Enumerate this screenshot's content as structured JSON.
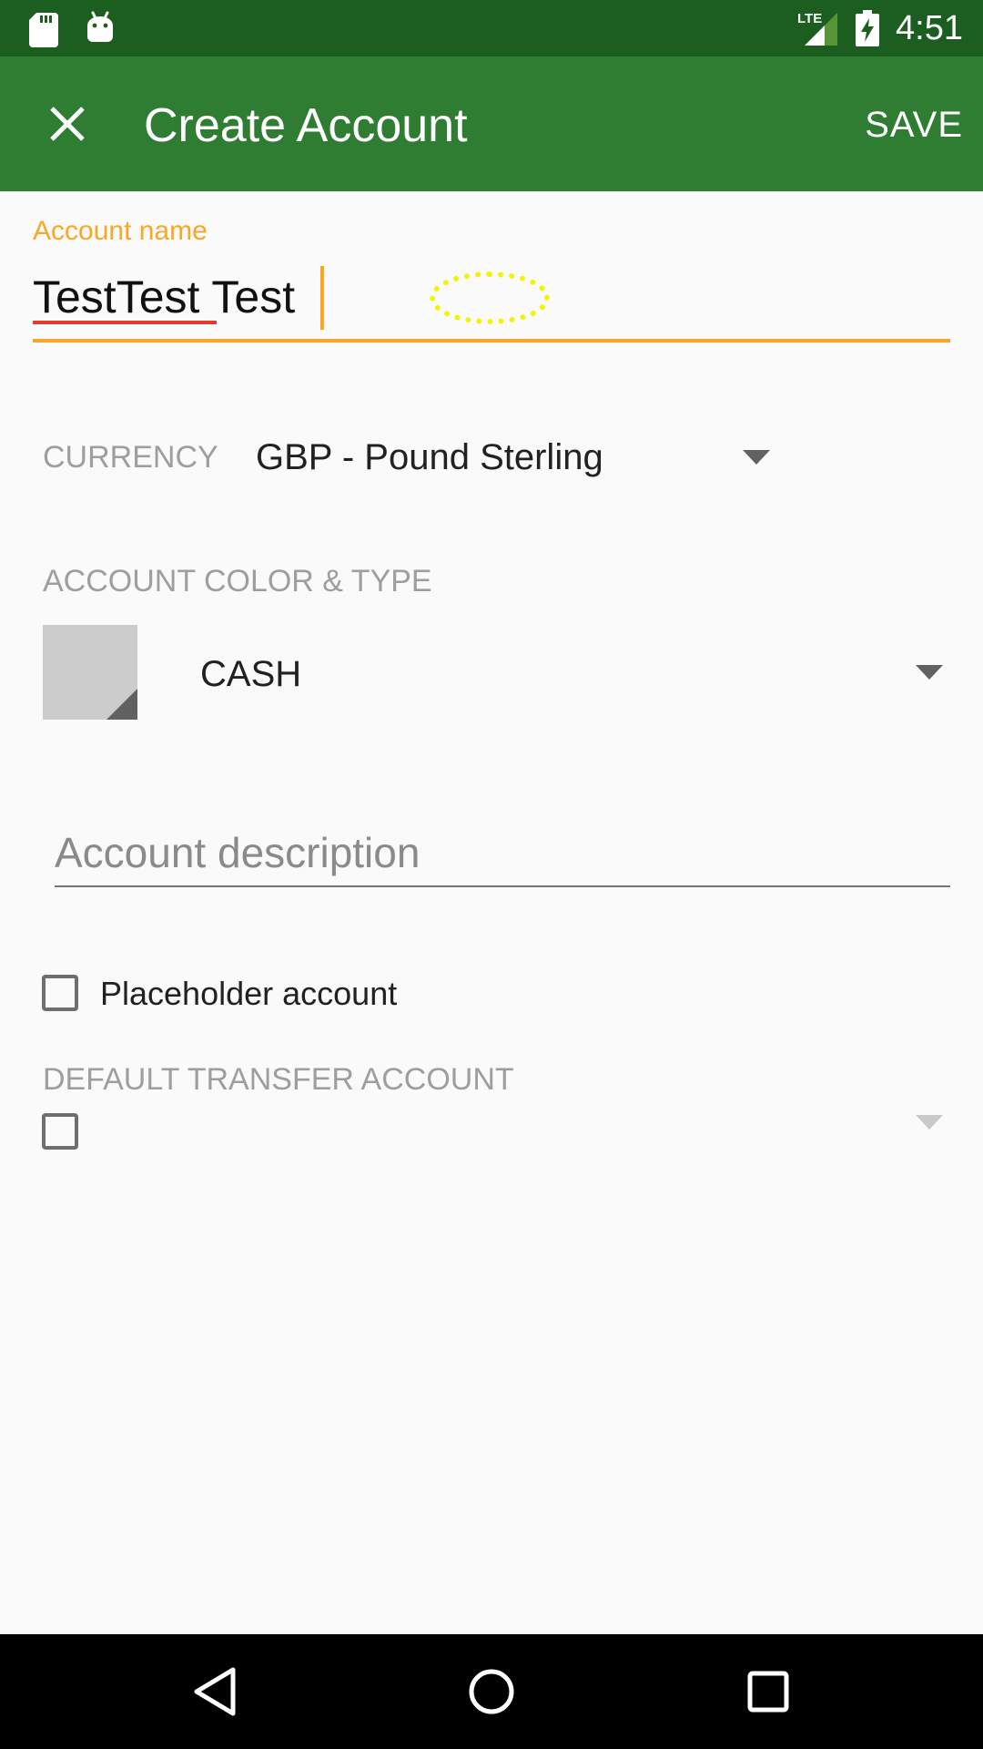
{
  "status_bar": {
    "time": "4:51",
    "network": "LTE",
    "icons": [
      "sd-card-icon",
      "android-debug-icon",
      "lte-signal-icon",
      "battery-charging-icon"
    ]
  },
  "toolbar": {
    "close_icon": "close-icon",
    "title": "Create Account",
    "save_label": "SAVE"
  },
  "form": {
    "account_name": {
      "label": "Account name",
      "value": "TestTest Test"
    },
    "currency": {
      "label": "CURRENCY",
      "value": "GBP - Pound Sterling"
    },
    "color_type": {
      "label": "ACCOUNT COLOR & TYPE",
      "swatch_color": "#cccccc",
      "type_value": "CASH"
    },
    "description": {
      "placeholder": "Account description",
      "value": ""
    },
    "placeholder_account": {
      "label": "Placeholder account",
      "checked": false
    },
    "default_transfer": {
      "label": "DEFAULT TRANSFER ACCOUNT",
      "checked": false
    }
  },
  "colors": {
    "status_bar": "#1b5e20",
    "toolbar": "#2e7d32",
    "accent": "#f9a825",
    "spell_error": "#e53935",
    "background": "#fafafa"
  },
  "nav_bar": {
    "icons": [
      "back-icon",
      "home-icon",
      "recents-icon"
    ]
  }
}
